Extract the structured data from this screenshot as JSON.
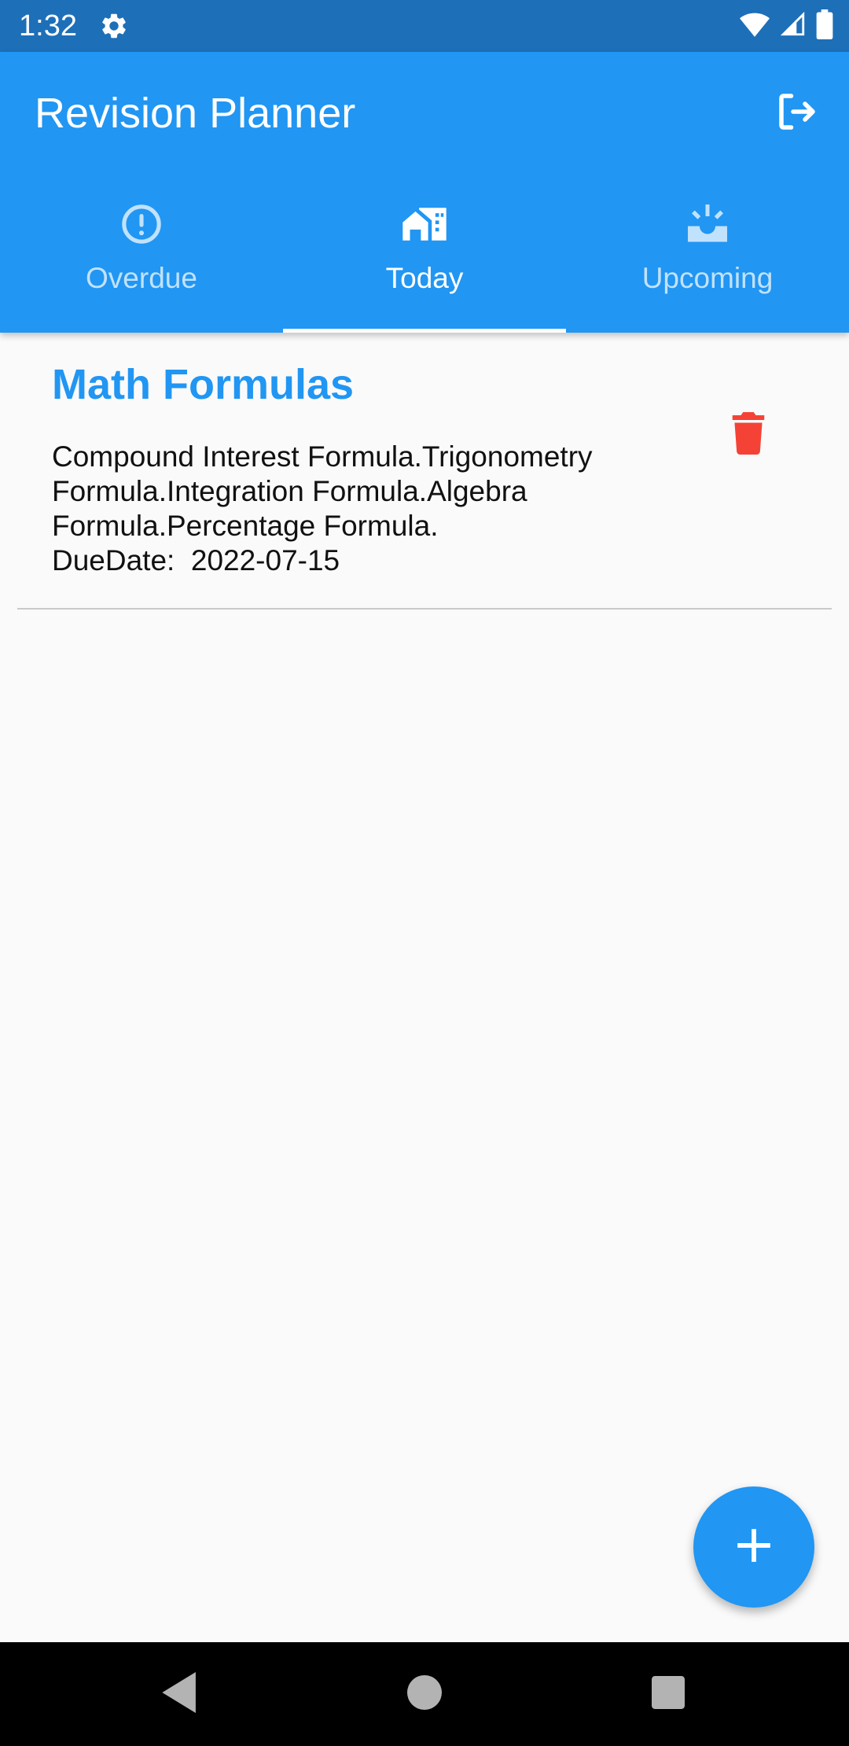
{
  "status_bar": {
    "time": "1:32",
    "icons": [
      "settings-icon",
      "wifi-icon",
      "signal-icon",
      "battery-icon"
    ]
  },
  "app_bar": {
    "title": "Revision Planner",
    "action_icon": "logout-icon"
  },
  "tabs": [
    {
      "label": "Overdue",
      "icon": "alert-circle-icon",
      "active": false
    },
    {
      "label": "Today",
      "icon": "home-work-icon",
      "active": true
    },
    {
      "label": "Upcoming",
      "icon": "upcoming-icon",
      "active": false
    }
  ],
  "items": [
    {
      "title": "Math Formulas",
      "description": "Compound Interest Formula.Trigonometry Formula.Integration Formula.Algebra Formula.Percentage Formula.",
      "due_label": "DueDate:  ",
      "due_date": "2022-07-15",
      "delete_icon": "trash-icon"
    }
  ],
  "fab": {
    "icon": "plus-icon"
  },
  "nav_bar": {
    "icons": [
      "back-icon",
      "home-icon",
      "recents-icon"
    ]
  },
  "colors": {
    "primary": "#2196f3",
    "status_bar": "#1d6fb8",
    "delete": "#f44336",
    "background": "#fafafa"
  }
}
